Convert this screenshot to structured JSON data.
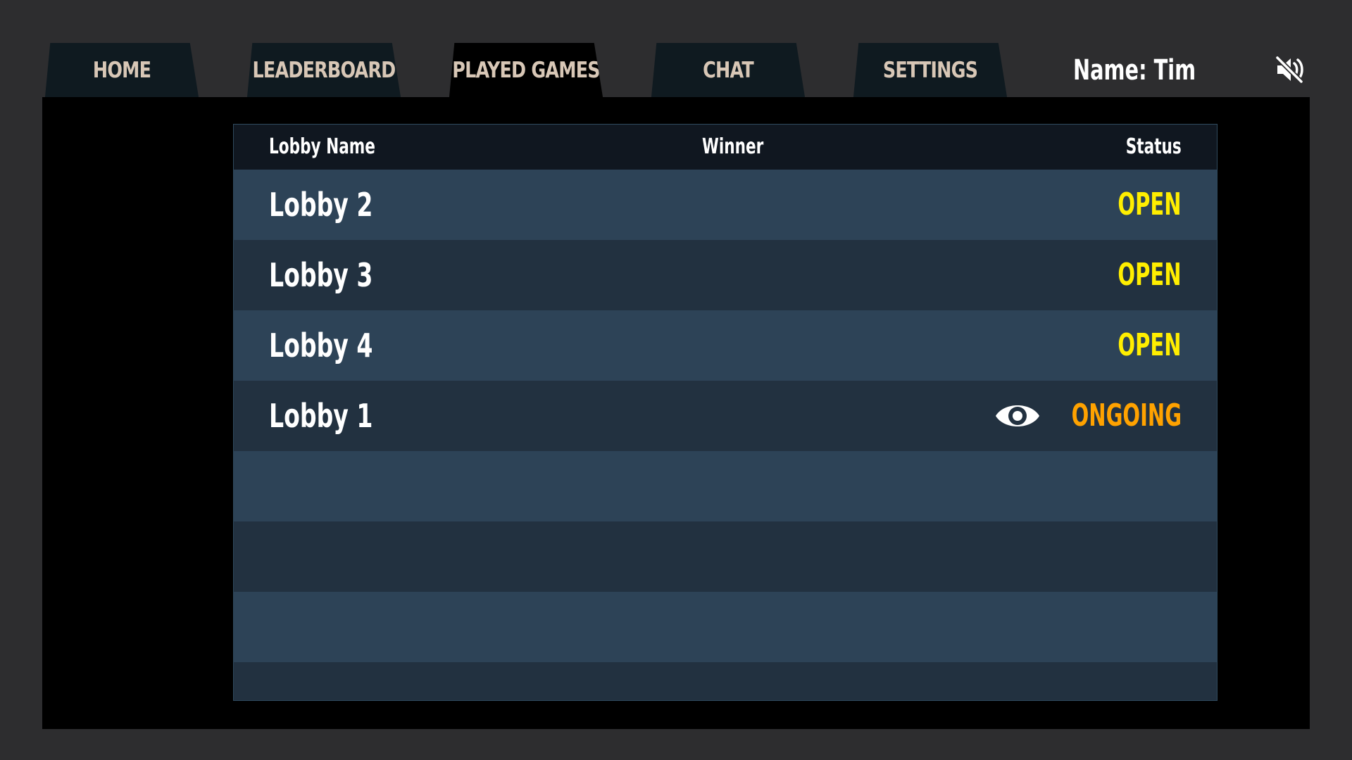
{
  "tabs": [
    {
      "label": "HOME"
    },
    {
      "label": "LEADERBOARD"
    },
    {
      "label": "PLAYED GAMES"
    },
    {
      "label": "CHAT"
    },
    {
      "label": "SETTINGS"
    }
  ],
  "active_tab": "PLAYED GAMES",
  "user": {
    "name_label": "Name: Tim"
  },
  "icons": {
    "mute": "volume-mute-icon",
    "spectate": "eye-icon"
  },
  "table": {
    "headers": {
      "lobby_name": "Lobby Name",
      "winner": "Winner",
      "status": "Status"
    },
    "rows": [
      {
        "lobby_name": "Lobby 2",
        "winner": "",
        "status": "OPEN",
        "status_color": "#ffee00"
      },
      {
        "lobby_name": "Lobby 3",
        "winner": "",
        "status": "OPEN",
        "status_color": "#ffee00"
      },
      {
        "lobby_name": "Lobby 4",
        "winner": "",
        "status": "OPEN",
        "status_color": "#ffee00"
      },
      {
        "lobby_name": "Lobby 1",
        "winner": "",
        "status": "ONGOING",
        "status_color": "#ffa200"
      }
    ]
  },
  "colors": {
    "page_background": "#2d2d2f",
    "tab_inactive": "#0f1a20",
    "tab_active": "#000000",
    "tab_text": "#d8c7b6",
    "row_light": "#2d4357",
    "row_dark": "#223140",
    "header_row": "#101720"
  }
}
